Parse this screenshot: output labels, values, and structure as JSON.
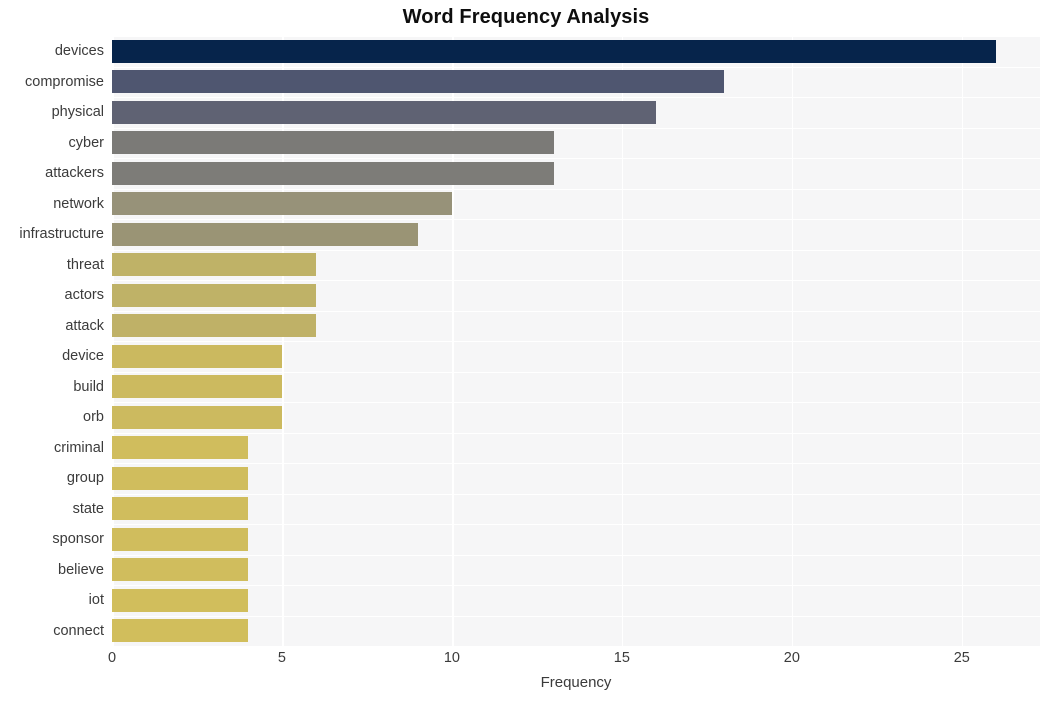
{
  "chart_data": {
    "type": "bar",
    "orientation": "horizontal",
    "title": "Word Frequency Analysis",
    "xlabel": "Frequency",
    "ylabel": "",
    "categories": [
      "devices",
      "compromise",
      "physical",
      "cyber",
      "attackers",
      "network",
      "infrastructure",
      "threat",
      "actors",
      "attack",
      "device",
      "build",
      "orb",
      "criminal",
      "group",
      "state",
      "sponsor",
      "believe",
      "iot",
      "connect"
    ],
    "values": [
      26,
      18,
      16,
      13,
      13,
      10,
      9,
      6,
      6,
      6,
      5,
      5,
      5,
      4,
      4,
      4,
      4,
      4,
      4,
      4
    ],
    "bar_colors": [
      "#06244b",
      "#4f5670",
      "#5f6273",
      "#7b7a77",
      "#7d7c78",
      "#979279",
      "#9a9475",
      "#bfb267",
      "#bfb267",
      "#bfb167",
      "#cbb95f",
      "#ccba5f",
      "#ccba5f",
      "#d0bd5d",
      "#d0bd5d",
      "#d0bd5d",
      "#d0bd5d",
      "#d0bd5d",
      "#d1be5c",
      "#d1be5c"
    ],
    "xticks": [
      0,
      5,
      10,
      15,
      20,
      25
    ],
    "xtick_labels": [
      "0",
      "5",
      "10",
      "15",
      "20",
      "25"
    ],
    "xlim": [
      0,
      27.3
    ],
    "grid": true,
    "grid_color": "#ffffff",
    "plot_background": "#f6f6f7",
    "figure_background": "#ffffff",
    "legend": null
  }
}
